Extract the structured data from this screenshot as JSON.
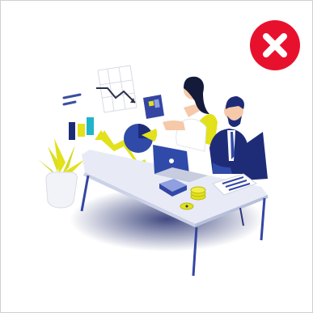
{
  "dialog": {
    "close_button": {
      "icon": "close-icon",
      "color": "#e8112d"
    }
  },
  "illustration": {
    "subject": "office-workers-at-desk",
    "icons": [
      "bar-chart-icon",
      "line-graph-icon",
      "pie-chart-icon",
      "laptop-icon",
      "coins-icon",
      "plant-icon"
    ],
    "colors": {
      "navy": "#1e2c78",
      "accent_yellow": "#e2e11a",
      "desk": "#e8ebf6",
      "skin": "#f6c9a9"
    }
  }
}
